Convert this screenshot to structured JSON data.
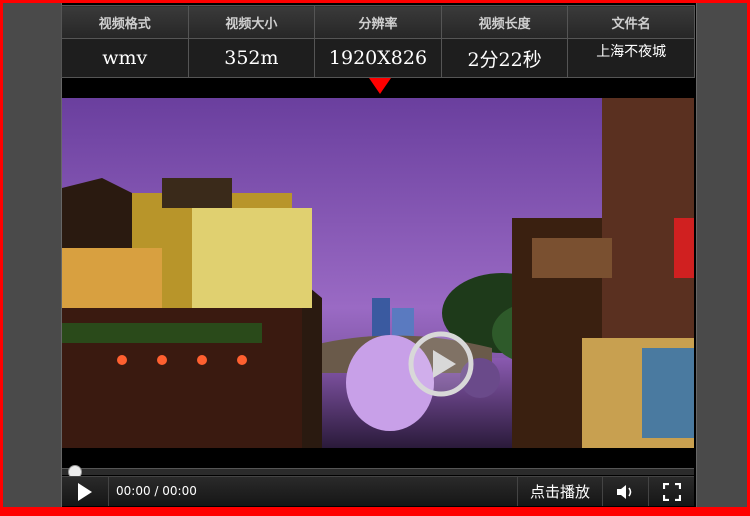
{
  "info": {
    "headers": [
      "视频格式",
      "视频大小",
      "分辨率",
      "视频长度",
      "文件名"
    ],
    "values": [
      "wmv",
      "352m",
      "1920X826",
      "2分22秒",
      "上海不夜城"
    ]
  },
  "player": {
    "time": "00:00 / 00:00",
    "click_play": "点击播放",
    "progress_fraction": 0.0
  },
  "colors": {
    "border": "#ff0000",
    "panel": "#000000",
    "sky": "#7a4fa8"
  },
  "icons": [
    "play-icon",
    "volume-icon",
    "fullscreen-icon",
    "big-play-icon",
    "pointer-triangle-icon"
  ]
}
